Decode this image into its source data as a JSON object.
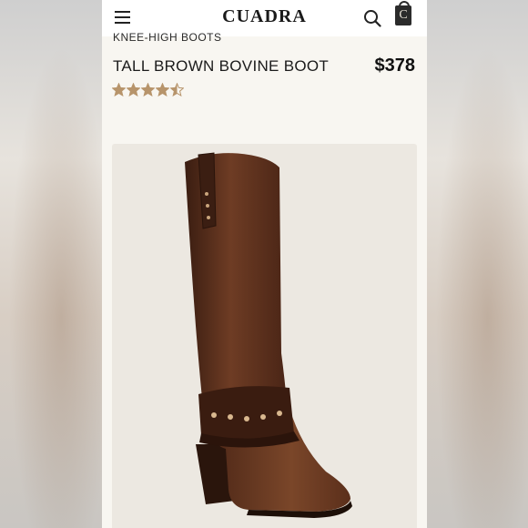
{
  "app": {
    "brand": "CUADRA",
    "bag_letter": "C"
  },
  "product": {
    "category": "KNEE-HIGH BOOTS",
    "title": "TALL BROWN BOVINE BOOT",
    "price": "$378",
    "rating": 4.5,
    "rating_max": 5
  },
  "icons": {
    "menu": "hamburger-icon",
    "search": "search-icon",
    "bag": "shopping-bag-icon",
    "star": "star-icon"
  },
  "colors": {
    "star": "#b7946b",
    "boot": "#5a2f1c",
    "card_bg": "#ece8e1"
  }
}
